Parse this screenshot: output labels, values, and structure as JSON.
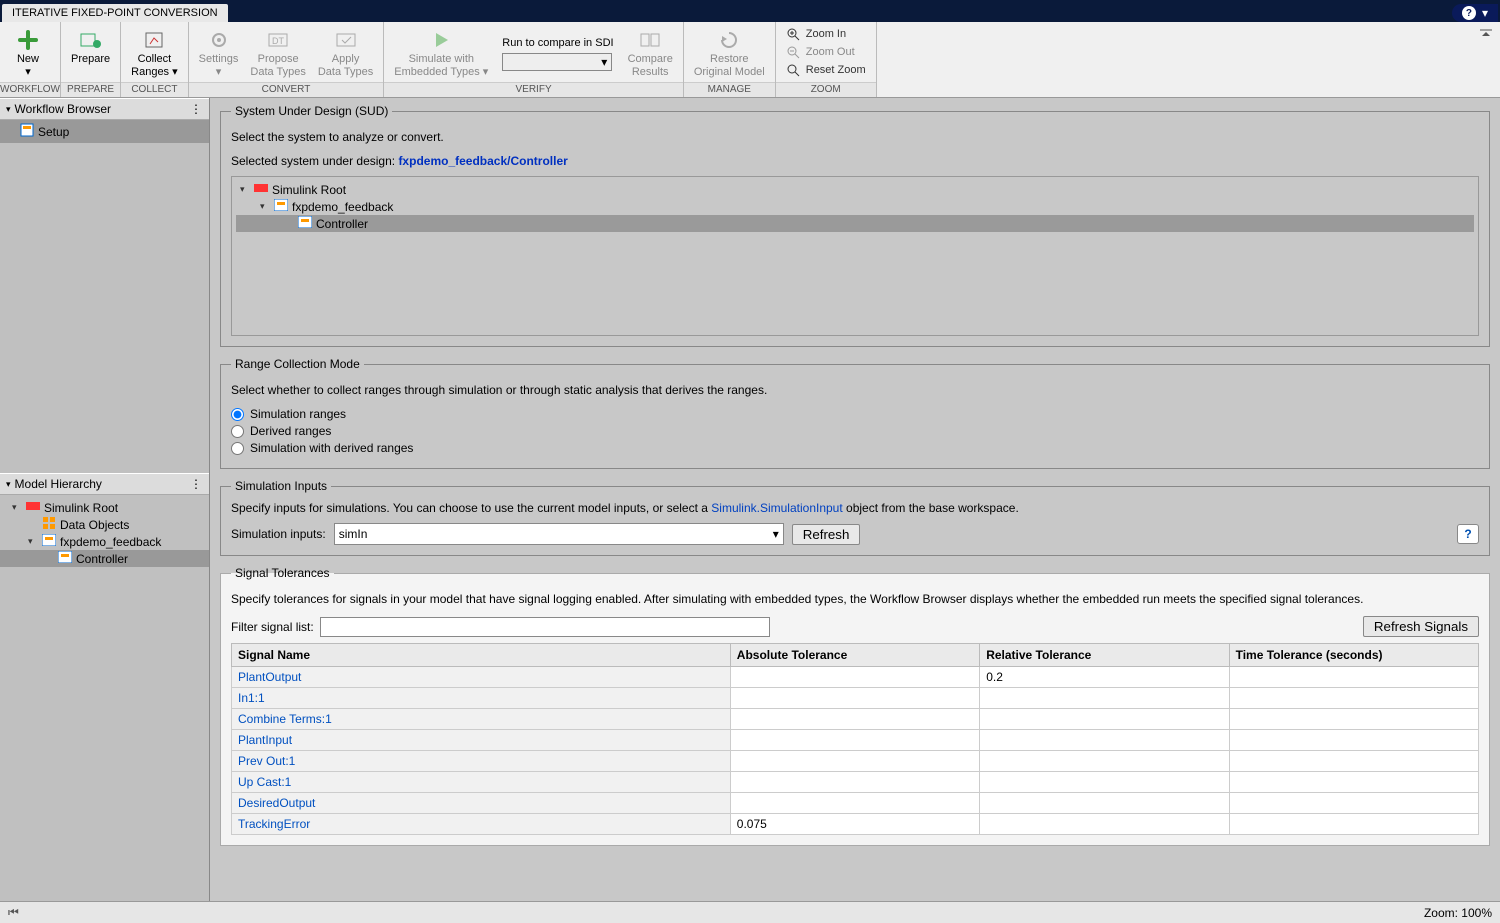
{
  "title": "ITERATIVE FIXED-POINT CONVERSION",
  "ribbon": {
    "new": "New",
    "prepare": "Prepare",
    "collect": "Collect\nRanges",
    "settings": "Settings",
    "propose": "Propose\nData Types",
    "apply": "Apply\nData Types",
    "simulate": "Simulate with\nEmbedded Types",
    "run_sdi": "Run to compare in SDI",
    "compare": "Compare\nResults",
    "restore": "Restore\nOriginal Model",
    "zoom_in": "Zoom In",
    "zoom_out": "Zoom Out",
    "reset_zoom": "Reset Zoom",
    "groups": {
      "workflow": "WORKFLOW",
      "prepare": "PREPARE",
      "collect": "COLLECT",
      "convert": "CONVERT",
      "verify": "VERIFY",
      "manage": "MANAGE",
      "zoom": "ZOOM"
    }
  },
  "workflow_panel": {
    "title": "Workflow Browser",
    "item": "Setup"
  },
  "model_hierarchy": {
    "title": "Model Hierarchy",
    "root": "Simulink Root",
    "data_objects": "Data Objects",
    "model": "fxpdemo_feedback",
    "controller": "Controller"
  },
  "sud": {
    "legend": "System Under Design (SUD)",
    "desc": "Select the system to analyze or convert.",
    "sel_label": "Selected system under design:",
    "sel_value": "fxpdemo_feedback/Controller",
    "tree_root": "Simulink Root",
    "tree_model": "fxpdemo_feedback",
    "tree_ctrl": "Controller"
  },
  "range_mode": {
    "legend": "Range Collection Mode",
    "desc": "Select whether to collect ranges through simulation or through static analysis that derives the ranges.",
    "opt1": "Simulation ranges",
    "opt2": "Derived ranges",
    "opt3": "Simulation with derived ranges"
  },
  "sim_inputs": {
    "legend": "Simulation Inputs",
    "desc_pre": "Specify inputs for simulations. You can choose to use the current model inputs, or select a ",
    "desc_link": "Simulink.SimulationInput",
    "desc_post": " object from the base workspace.",
    "label": "Simulation inputs:",
    "value": "simIn",
    "refresh": "Refresh"
  },
  "sig_tol": {
    "legend": "Signal Tolerances",
    "desc": "Specify tolerances for signals in your model that have signal logging enabled. After simulating with embedded types, the Workflow Browser displays whether the embedded run meets the specified signal tolerances.",
    "filter_label": "Filter signal list:",
    "refresh": "Refresh Signals",
    "cols": {
      "name": "Signal Name",
      "abs": "Absolute Tolerance",
      "rel": "Relative Tolerance",
      "time": "Time Tolerance (seconds)"
    },
    "rows": [
      {
        "name": "PlantOutput",
        "abs": "",
        "rel": "0.2",
        "time": ""
      },
      {
        "name": "In1:1",
        "abs": "",
        "rel": "",
        "time": ""
      },
      {
        "name": "Combine Terms:1",
        "abs": "",
        "rel": "",
        "time": ""
      },
      {
        "name": "PlantInput",
        "abs": "",
        "rel": "",
        "time": ""
      },
      {
        "name": "Prev Out:1",
        "abs": "",
        "rel": "",
        "time": ""
      },
      {
        "name": "Up Cast:1",
        "abs": "",
        "rel": "",
        "time": ""
      },
      {
        "name": "DesiredOutput",
        "abs": "",
        "rel": "",
        "time": ""
      },
      {
        "name": "TrackingError",
        "abs": "0.075",
        "rel": "",
        "time": ""
      }
    ]
  },
  "status": {
    "zoom": "Zoom: 100%"
  }
}
